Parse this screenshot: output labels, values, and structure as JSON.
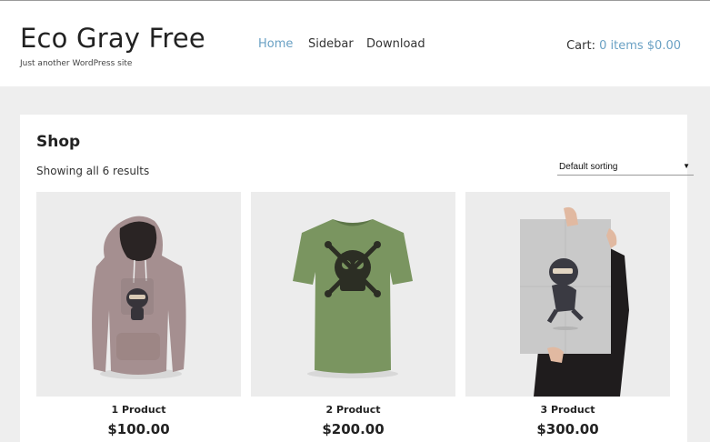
{
  "site": {
    "title": "Eco Gray Free",
    "tagline": "Just another WordPress site"
  },
  "nav": [
    {
      "label": "Home",
      "active": true
    },
    {
      "label": "Sidebar",
      "active": false
    },
    {
      "label": "Download",
      "active": false
    }
  ],
  "cart": {
    "label": "Cart:",
    "summary": "0 items $0.00"
  },
  "shop": {
    "title": "Shop",
    "result_count": "Showing all 6 results",
    "sorting": "Default sorting"
  },
  "products": [
    {
      "name": "1 Product",
      "price": "$100.00",
      "image": "hoodie-with-ninja-print"
    },
    {
      "name": "2 Product",
      "price": "$200.00",
      "image": "green-tshirt-with-skull-print"
    },
    {
      "name": "3 Product",
      "price": "$300.00",
      "image": "ninja-poster"
    }
  ],
  "colors": {
    "accent": "#6aa1c4",
    "page_bg": "#eeeeee",
    "card_bg": "#ececec"
  }
}
